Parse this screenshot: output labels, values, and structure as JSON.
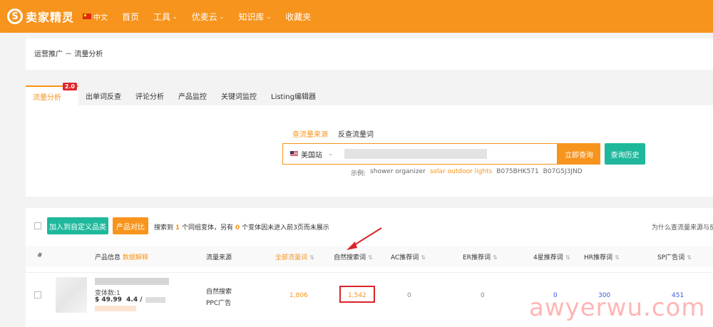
{
  "nav": {
    "logo_text": "卖家精灵",
    "lang": "中文",
    "items": [
      {
        "label": "首页",
        "has_caret": false
      },
      {
        "label": "工具",
        "has_caret": true
      },
      {
        "label": "优麦云",
        "has_caret": true
      },
      {
        "label": "知识库",
        "has_caret": true
      },
      {
        "label": "收藏夹",
        "has_caret": false
      }
    ]
  },
  "breadcrumb": "运营推广 － 流量分析",
  "tabs": [
    {
      "label": "流量分析",
      "active": true,
      "badge": "2.0"
    },
    {
      "label": "出单词反查"
    },
    {
      "label": "评论分析"
    },
    {
      "label": "产品监控"
    },
    {
      "label": "关键词监控"
    },
    {
      "label": "Listing编辑器"
    }
  ],
  "search": {
    "mode_tabs": [
      "查流量来源",
      "反查流量词"
    ],
    "site": "美国站",
    "query_button": "立即查询",
    "history_button": "查询历史",
    "examples_label": "示例:",
    "examples": [
      "shower organizer",
      "solar outdoor lights",
      "B075BHK571",
      "B07G5J3JND"
    ]
  },
  "toolbar": {
    "add_category_button": "加入到自定义品类",
    "compare_button": "产品对比",
    "result_prefix": "搜索到",
    "result_count": "1",
    "result_mid": "个同组变体，另有",
    "result_hidden": "0",
    "result_suffix": "个变体因未进入前3页而未展示",
    "why_link": "为什么查流量来源与反"
  },
  "table": {
    "headers": {
      "index": "#",
      "product": "产品信息",
      "product_link": "数据解释",
      "source": "流量来源",
      "all_keywords": "全部流量词",
      "organic": "自然搜索词",
      "ac": "AC推荐词",
      "er": "ER推荐词",
      "four_star": "4星推荐词",
      "hr": "HR推荐词",
      "sp": "SP广告词"
    },
    "row": {
      "variants": "变体数:1",
      "price": "$ 49.99",
      "rating": "4.4 /",
      "source_organic": "自然搜索",
      "source_ppc": "PPC广告",
      "all_keywords": "1,806",
      "organic": "1,542",
      "ac": "0",
      "er": "0",
      "four_star": "0",
      "hr": "300",
      "sp": "451"
    }
  },
  "watermark": "awyerwu.com",
  "colors": {
    "brand_orange": "#f7941d",
    "green": "#1fb89c",
    "highlight_red": "#d9252b",
    "link_blue": "#3b5bdb"
  }
}
